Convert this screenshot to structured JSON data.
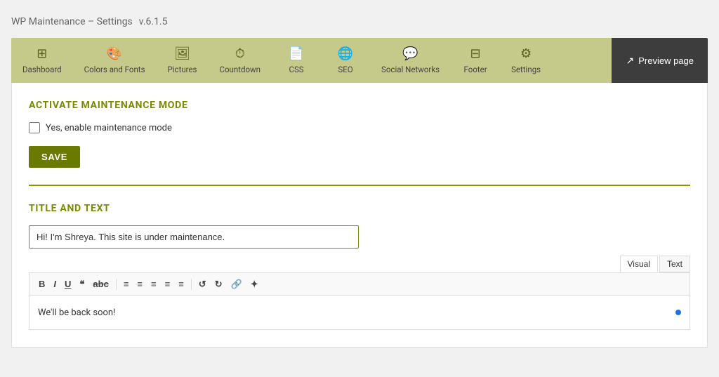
{
  "page": {
    "title": "WP Maintenance – Settings",
    "version": "v.6.1.5"
  },
  "nav": {
    "items": [
      {
        "id": "dashboard",
        "label": "Dashboard",
        "icon": "⊞"
      },
      {
        "id": "colors-fonts",
        "label": "Colors and Fonts",
        "icon": "🎨"
      },
      {
        "id": "pictures",
        "label": "Pictures",
        "icon": "🖼"
      },
      {
        "id": "countdown",
        "label": "Countdown",
        "icon": "⏱"
      },
      {
        "id": "css",
        "label": "CSS",
        "icon": "📄"
      },
      {
        "id": "seo",
        "label": "SEO",
        "icon": "🌐"
      },
      {
        "id": "social-networks",
        "label": "Social Networks",
        "icon": "💬"
      },
      {
        "id": "footer",
        "label": "Footer",
        "icon": "⊟"
      },
      {
        "id": "settings",
        "label": "Settings",
        "icon": "⚙"
      }
    ],
    "preview_label": "Preview page"
  },
  "activate_section": {
    "title": "ACTIVATE MAINTENANCE MODE",
    "checkbox_label": "Yes, enable maintenance mode",
    "checkbox_checked": false,
    "save_label": "SAVE"
  },
  "title_text_section": {
    "title": "TITLE AND TEXT",
    "input_value": "Hi! I'm Shreya. This site is under maintenance.",
    "editor_tabs": [
      "Visual",
      "Text"
    ],
    "active_tab": "Visual",
    "toolbar_buttons": [
      "B",
      "I",
      "U",
      "❝",
      "abc",
      "≡",
      "≡",
      "≡",
      "≡",
      "≡",
      "↺",
      "↻",
      "🔗",
      "✦"
    ],
    "editor_content": "We'll be back soon!"
  }
}
